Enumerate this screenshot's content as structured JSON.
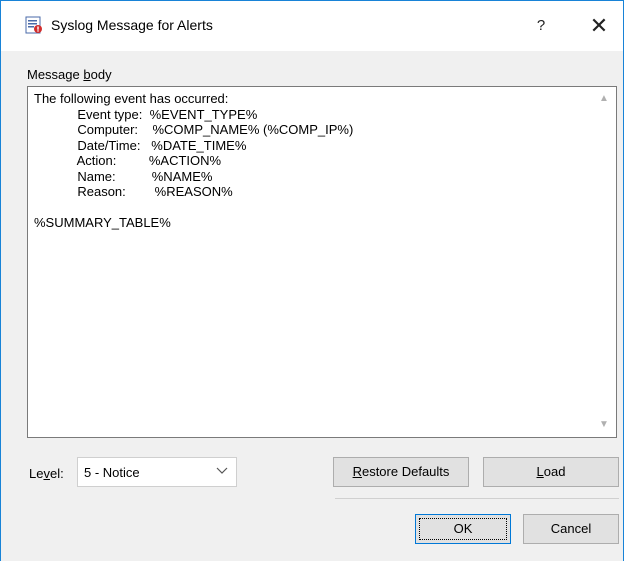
{
  "window": {
    "title": "Syslog Message for Alerts",
    "help_glyph": "?",
    "close_glyph": "✕",
    "app_icon": "syslog-app-icon"
  },
  "message": {
    "label_prefix": "Message ",
    "label_accel": "b",
    "label_suffix": "ody",
    "body": "The following event has occurred:\n            Event type:  %EVENT_TYPE%\n            Computer:    %COMP_NAME% (%COMP_IP%)\n            Date/Time:   %DATE_TIME%\n            Action:         %ACTION%\n            Name:          %NAME%\n            Reason:        %REASON%\n\n%SUMMARY_TABLE%"
  },
  "level": {
    "label_prefix": "Le",
    "label_accel": "v",
    "label_suffix": "el:",
    "selected": "5 - Notice"
  },
  "buttons": {
    "restore_accel": "R",
    "restore_rest": "estore Defaults",
    "load_accel": "L",
    "load_rest": "oad",
    "ok": "OK",
    "cancel": "Cancel"
  },
  "colors": {
    "window_border": "#1883d7",
    "dialog_bg": "#f0f0f0",
    "default_button_border": "#0078d7"
  }
}
